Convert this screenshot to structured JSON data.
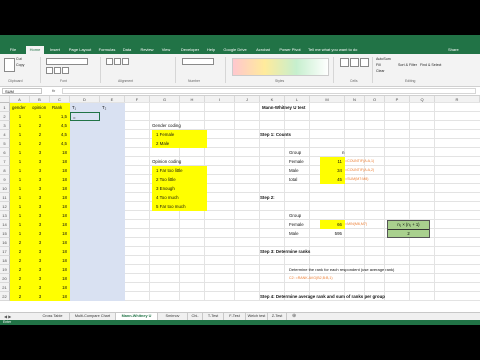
{
  "window": {
    "title": "",
    "share": "Share",
    "tell_me": "Tell me what you want to do"
  },
  "ribbon_tabs": [
    "File",
    "Home",
    "Insert",
    "Page Layout",
    "Formulas",
    "Data",
    "Review",
    "View",
    "Developer",
    "Help",
    "Google Drive",
    "Acrobat",
    "Power Pivot"
  ],
  "ribbon": {
    "cut": "Cut",
    "copy": "Copy",
    "clipboard": "Clipboard",
    "font": "Font",
    "alignment": "Alignment",
    "number": "Number",
    "styles": "Styles",
    "cells": "Cells",
    "editing": "Editing",
    "autosum": "AutoSum",
    "fill": "Fill",
    "clear": "Clear",
    "sort_filter": "Sort & Filter",
    "find_select": "Find & Select"
  },
  "formula_bar": {
    "name_box": "SUM",
    "formula": "fx"
  },
  "columns": [
    "A",
    "B",
    "C",
    "D",
    "E",
    "F",
    "G",
    "H",
    "I",
    "J",
    "K",
    "L",
    "M",
    "N",
    "O",
    "P",
    "Q",
    "R"
  ],
  "rows": [
    "1",
    "2",
    "3",
    "4",
    "5",
    "6",
    "7",
    "8",
    "9",
    "10",
    "11",
    "12",
    "13",
    "14",
    "15",
    "16",
    "17",
    "18",
    "19",
    "20",
    "21",
    "22"
  ],
  "headers": {
    "gender": "gender",
    "opinion": "opinion",
    "rank": "Rank",
    "t1": "T₁",
    "t2": "T₂"
  },
  "d2_value": "=",
  "data_rows": [
    [
      "1",
      "1",
      "1,5"
    ],
    [
      "1",
      "2",
      "4,5"
    ],
    [
      "1",
      "2",
      "4,5"
    ],
    [
      "1",
      "2",
      "4,5"
    ],
    [
      "1",
      "3",
      "18"
    ],
    [
      "1",
      "3",
      "18"
    ],
    [
      "1",
      "3",
      "18"
    ],
    [
      "1",
      "3",
      "18"
    ],
    [
      "1",
      "3",
      "18"
    ],
    [
      "1",
      "3",
      "18"
    ],
    [
      "1",
      "3",
      "18"
    ],
    [
      "1",
      "3",
      "18"
    ],
    [
      "1",
      "3",
      "18"
    ],
    [
      "1",
      "3",
      "18"
    ],
    [
      "2",
      "3",
      "18"
    ],
    [
      "2",
      "3",
      "18"
    ],
    [
      "2",
      "3",
      "18"
    ],
    [
      "2",
      "3",
      "18"
    ],
    [
      "2",
      "3",
      "18"
    ],
    [
      "2",
      "3",
      "18"
    ],
    [
      "2",
      "3",
      "18"
    ]
  ],
  "gender_coding": {
    "title": "Gender coding",
    "items": [
      "1  Female",
      "2  Male"
    ]
  },
  "opinion_coding": {
    "title": "Opinion coding",
    "items": [
      "1  Far too little",
      "2  Too little",
      "3  Enough",
      "4  Too much",
      "5  Far too much"
    ]
  },
  "right": {
    "title": "Mann-Whitney U test",
    "step1": "Step 1: Counts",
    "group": "Group",
    "n": "n",
    "female": "Female",
    "female_n": "11",
    "female_formula": "=COUNTIF(A:A,1)",
    "male": "Male",
    "male_n": "34",
    "male_formula": "=COUNTIF(A:A,2)",
    "total": "total",
    "total_n": "45",
    "total_formula": "=SUM(M7:M8)",
    "step2": "Step 2:",
    "group2": "Group",
    "female2": "Female",
    "female2_val": "66",
    "female2_formula": "=MIN(M6,M7)",
    "male2": "Male",
    "male2_val": "595",
    "formula_box": "n₁ × (n₁ + 1)",
    "formula_box_den": "2",
    "step3": "Step 3: Determine ranks",
    "step3_desc": "Determine the rank for each respondent (use average rank)",
    "step3_formula": "C2: =RANK.AVG(B2,B:B,1)",
    "step4": "Step 4: Determine average rank and sum of ranks per group"
  },
  "sheet_tabs": [
    "Cross Table",
    "Multi-Compare Chart",
    "Mann-Whitney U",
    "Smirnov",
    "Chi-Square",
    "T-Test",
    "F-Test",
    "Welch test",
    "Z-Test"
  ],
  "active_sheet": "Mann-Whitney U",
  "status": "Enter",
  "colors": {
    "excel_green": "#217346",
    "cell_yellow": "#ffff00",
    "cell_blue": "#d9e1f2",
    "formula_orange": "#ed7d31",
    "box_green": "#a9d08e"
  }
}
